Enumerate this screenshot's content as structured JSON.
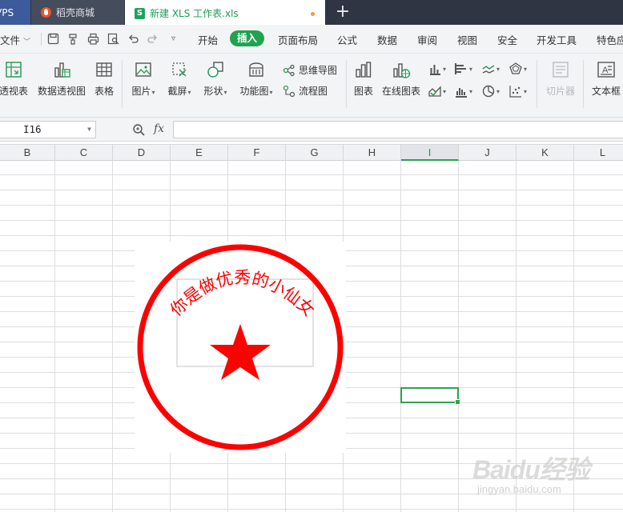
{
  "tabs": {
    "wps": "VPS",
    "daoke": "稻壳商城",
    "file": "新建 XLS 工作表.xls",
    "file_icon": "S",
    "new_tab_symbol": "+"
  },
  "menu": {
    "file": "文件",
    "items": [
      "开始",
      "插入",
      "页面布局",
      "公式",
      "数据",
      "审阅",
      "视图",
      "安全",
      "开发工具",
      "特色应"
    ],
    "active": "插入",
    "active_color": "#1fa351"
  },
  "ribbon": {
    "pivot_table": "透视表",
    "pivot_chart": "数据透视图",
    "table": "表格",
    "picture": "图片",
    "screenshot": "截屏",
    "shape": "形状",
    "function_chart": "功能图",
    "mind_map": "思维导图",
    "flowchart": "流程图",
    "chart": "图表",
    "online_chart": "在线图表",
    "slicer": "切片器",
    "textbox": "文本框",
    "dropdown_mark": "▾"
  },
  "formula_bar": {
    "cell_ref": "I16",
    "fx_label": "fx",
    "formula": ""
  },
  "grid": {
    "columns": [
      "B",
      "C",
      "D",
      "E",
      "F",
      "G",
      "H",
      "I",
      "J",
      "K",
      "L"
    ],
    "selected_column": "I",
    "selection_color": "#2ea24f"
  },
  "stamp": {
    "text": "你是做优秀的小仙女",
    "color": "#ff0000"
  },
  "watermark": {
    "logo": "Baidu经验",
    "url": "jingyan.baidu.com"
  }
}
